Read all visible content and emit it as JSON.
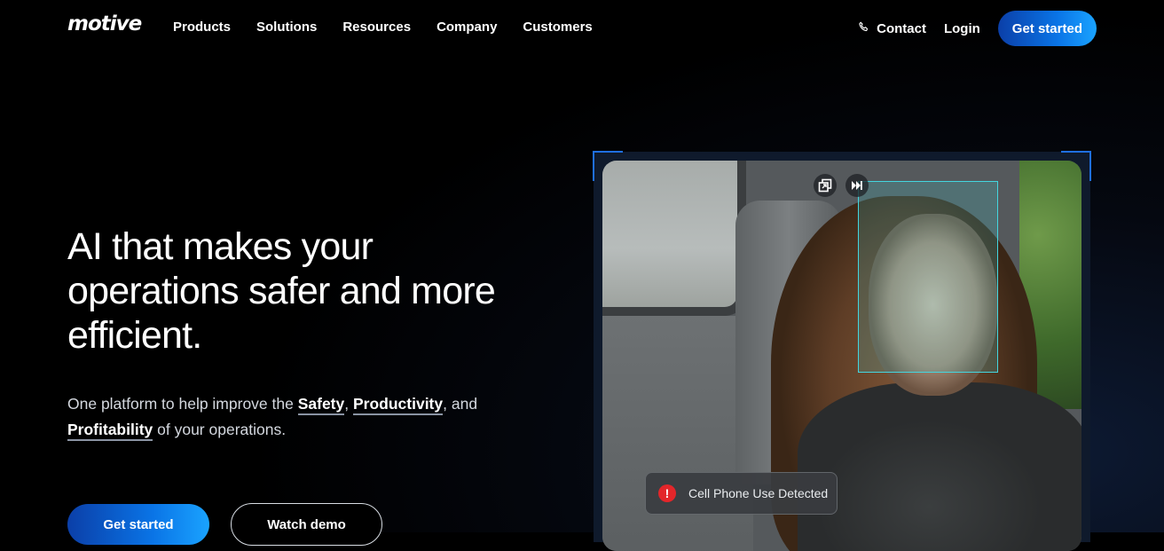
{
  "header": {
    "logo": "motive",
    "nav": [
      "Products",
      "Solutions",
      "Resources",
      "Company",
      "Customers"
    ],
    "contact_label": "Contact",
    "login_label": "Login",
    "cta_label": "Get started"
  },
  "hero": {
    "headline": "AI that makes your operations safer and more efficient.",
    "sub_prefix": "One platform to help improve the ",
    "highlight_1": "Safety",
    "sep_1": ", ",
    "highlight_2": "Productivity",
    "sep_2": ", and ",
    "highlight_3": "Profitability",
    "sub_suffix": " of your operations.",
    "cta_primary": "Get started",
    "cta_secondary": "Watch demo"
  },
  "media": {
    "alert_text": "Cell Phone Use Detected",
    "alert_symbol": "!",
    "controls": [
      "pip-icon",
      "skip-forward-icon"
    ]
  },
  "colors": {
    "accent_blue": "#0a74e6",
    "detection_box": "#43d6e0",
    "alert_red": "#e3262a"
  }
}
